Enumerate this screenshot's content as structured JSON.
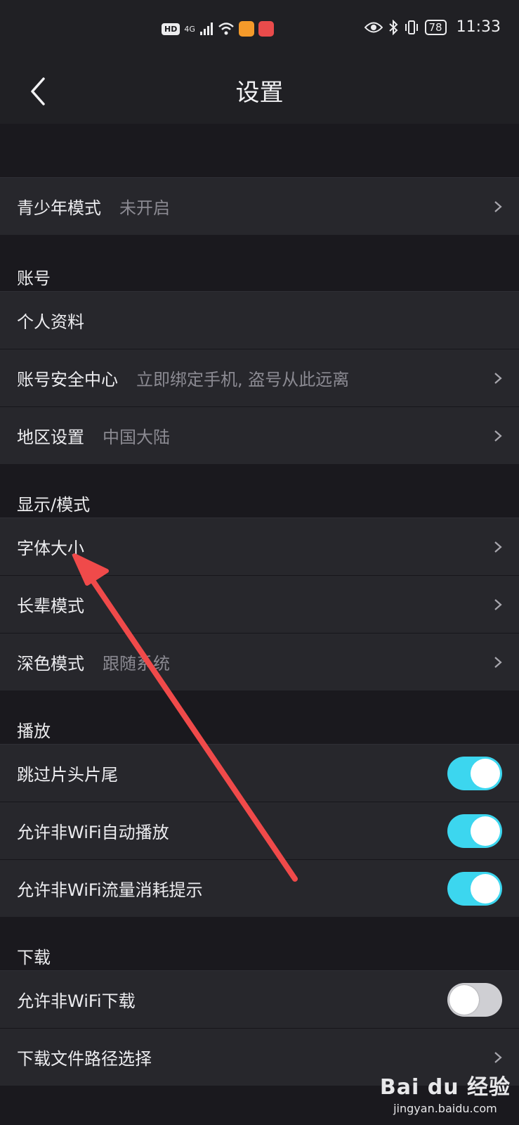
{
  "status_bar": {
    "hd": "HD",
    "network": "4G",
    "battery": "78",
    "time": "11:33"
  },
  "nav": {
    "title": "设置"
  },
  "teen_mode": {
    "label": "青少年模式",
    "value": "未开启"
  },
  "account": {
    "header": "账号",
    "profile_label": "个人资料",
    "security_label": "账号安全中心",
    "security_value": "立即绑定手机, 盗号从此远离",
    "region_label": "地区设置",
    "region_value": "中国大陆"
  },
  "display": {
    "header": "显示/模式",
    "font_size_label": "字体大小",
    "elder_label": "长辈模式",
    "dark_label": "深色模式",
    "dark_value": "跟随系统"
  },
  "playback": {
    "header": "播放",
    "skip_label": "跳过片头片尾",
    "skip_on": true,
    "autoplay_label": "允许非WiFi自动播放",
    "autoplay_on": true,
    "data_hint_label": "允许非WiFi流量消耗提示",
    "data_hint_on": true
  },
  "download": {
    "header": "下载",
    "non_wifi_label": "允许非WiFi下载",
    "non_wifi_on": false,
    "path_label": "下载文件路径选择"
  },
  "watermark": {
    "brand": "Bai du 经验",
    "url": "jingyan.baidu.com"
  },
  "colors": {
    "toggle_on": "#3cd6ef",
    "annotation_arrow": "#f04a4a"
  }
}
